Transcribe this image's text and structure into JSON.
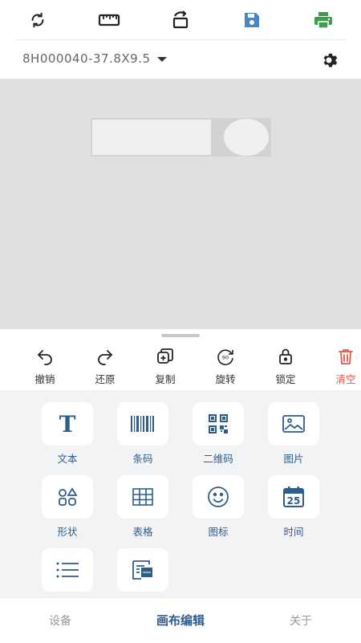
{
  "toolbar": {
    "icons": [
      "refresh-icon",
      "ruler-icon",
      "rotate-canvas-icon",
      "save-icon",
      "print-icon"
    ],
    "colors": {
      "save": "#4a86c5",
      "print": "#3aa04a",
      "default": "#222222"
    }
  },
  "label": {
    "name": "8H000040-37.8X9.5"
  },
  "actions": [
    {
      "label": "撤销",
      "icon": "undo-icon"
    },
    {
      "label": "还原",
      "icon": "redo-icon"
    },
    {
      "label": "复制",
      "icon": "copy-icon"
    },
    {
      "label": "旋转",
      "icon": "rotate-90-icon"
    },
    {
      "label": "锁定",
      "icon": "lock-icon"
    },
    {
      "label": "清空",
      "icon": "trash-icon"
    }
  ],
  "elements": [
    {
      "label": "文本",
      "icon": "text-icon"
    },
    {
      "label": "条码",
      "icon": "barcode-icon"
    },
    {
      "label": "二维码",
      "icon": "qrcode-icon"
    },
    {
      "label": "图片",
      "icon": "image-icon"
    },
    {
      "label": "形状",
      "icon": "shapes-icon"
    },
    {
      "label": "表格",
      "icon": "table-icon"
    },
    {
      "label": "图标",
      "icon": "smiley-icon"
    },
    {
      "label": "时间",
      "icon": "calendar-icon"
    },
    {
      "label": "",
      "icon": "list-icon"
    },
    {
      "label": "",
      "icon": "serial-number-icon"
    }
  ],
  "calendar_day": "25",
  "nav": [
    {
      "label": "设备",
      "active": false
    },
    {
      "label": "画布编辑",
      "active": true
    },
    {
      "label": "关于",
      "active": false
    }
  ],
  "colors": {
    "accent": "#2f5d8a",
    "danger": "#e05a4a",
    "canvas": "#e0e0e0",
    "panel": "#f2f3f5"
  }
}
